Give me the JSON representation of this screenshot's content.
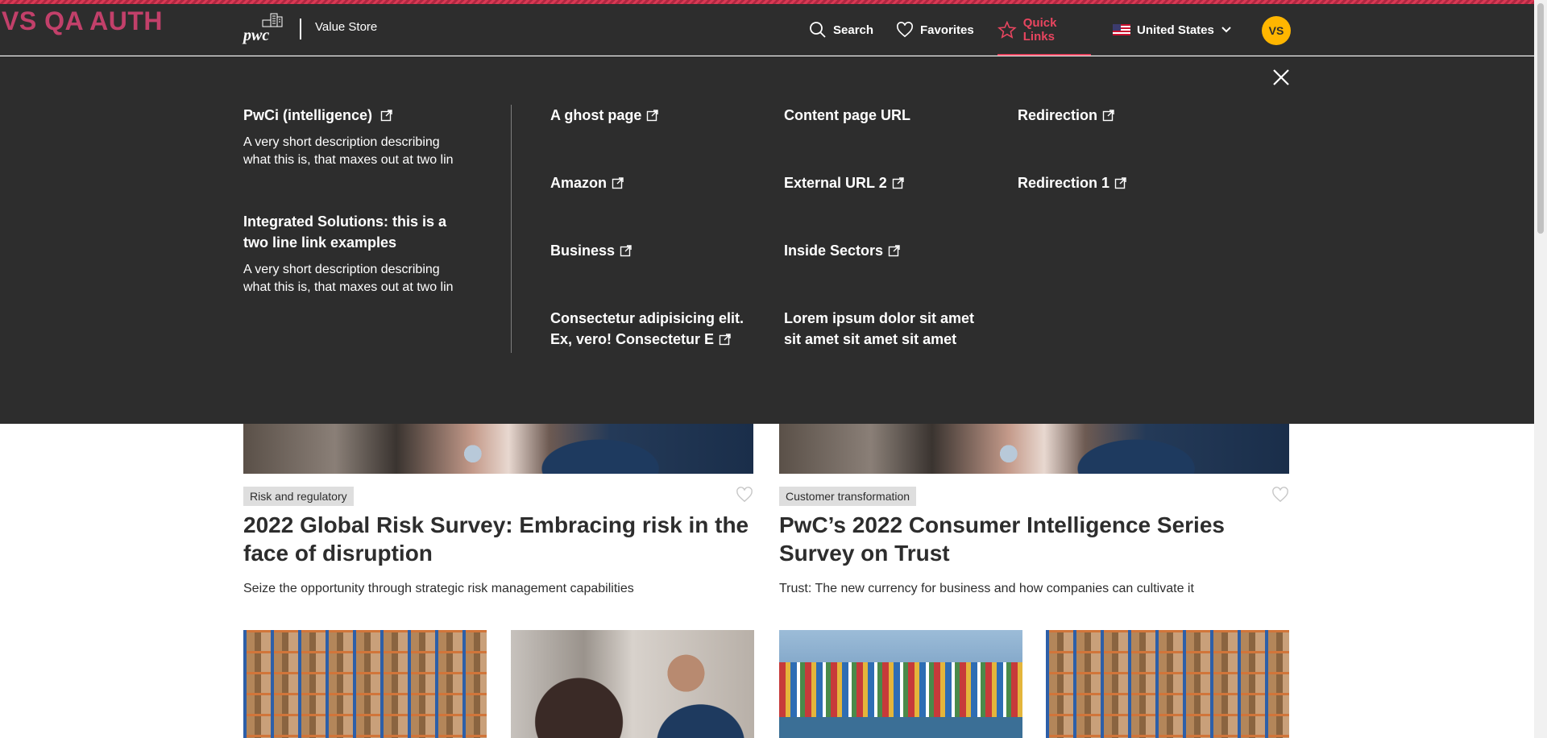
{
  "env_label": "VS QA AUTH",
  "header": {
    "logo_text": "pwc",
    "site_name": "Value Store",
    "nav": {
      "search": "Search",
      "favorites": "Favorites",
      "quick_links": "Quick Links",
      "country": "United States"
    },
    "avatar_initials": "VS",
    "colors": {
      "background": "#2d2d2d",
      "accent": "#e8455f",
      "avatar": "#ffb600"
    }
  },
  "mega_menu": {
    "featured": [
      {
        "title": "PwCi (intelligence)",
        "external": true,
        "description": "A very short description describing what this is, that maxes out at two lin"
      },
      {
        "title": "Integrated Solutions: this is a two line link examples",
        "external": false,
        "description": "A very short description describing what this is, that maxes out at two lin"
      }
    ],
    "links": {
      "col1": [
        {
          "label": "A ghost page",
          "external": true
        },
        {
          "label": "Amazon",
          "external": true
        },
        {
          "label": "Business",
          "external": true
        },
        {
          "label": "Consectetur adipisicing elit. Ex, vero! Consectetur E",
          "external": true
        }
      ],
      "col2": [
        {
          "label": "Content page URL",
          "external": false
        },
        {
          "label": "External URL 2",
          "external": true
        },
        {
          "label": "Inside Sectors",
          "external": true
        },
        {
          "label": "Lorem ipsum dolor sit amet sit amet sit amet sit amet",
          "external": false
        }
      ],
      "col3": [
        {
          "label": "Redirection",
          "external": true
        },
        {
          "label": "Redirection 1",
          "external": true
        }
      ]
    }
  },
  "cards": [
    {
      "tag": "Risk and regulatory",
      "title": "2022 Global Risk Survey: Embracing risk in the face of disruption",
      "description": "Seize the opportunity through strategic risk management capabilities"
    },
    {
      "tag": "Customer transformation",
      "title": "PwC’s 2022 Consumer Intelligence Series Survey on Trust",
      "description": "Trust: The new currency for business and how companies can cultivate it"
    }
  ]
}
